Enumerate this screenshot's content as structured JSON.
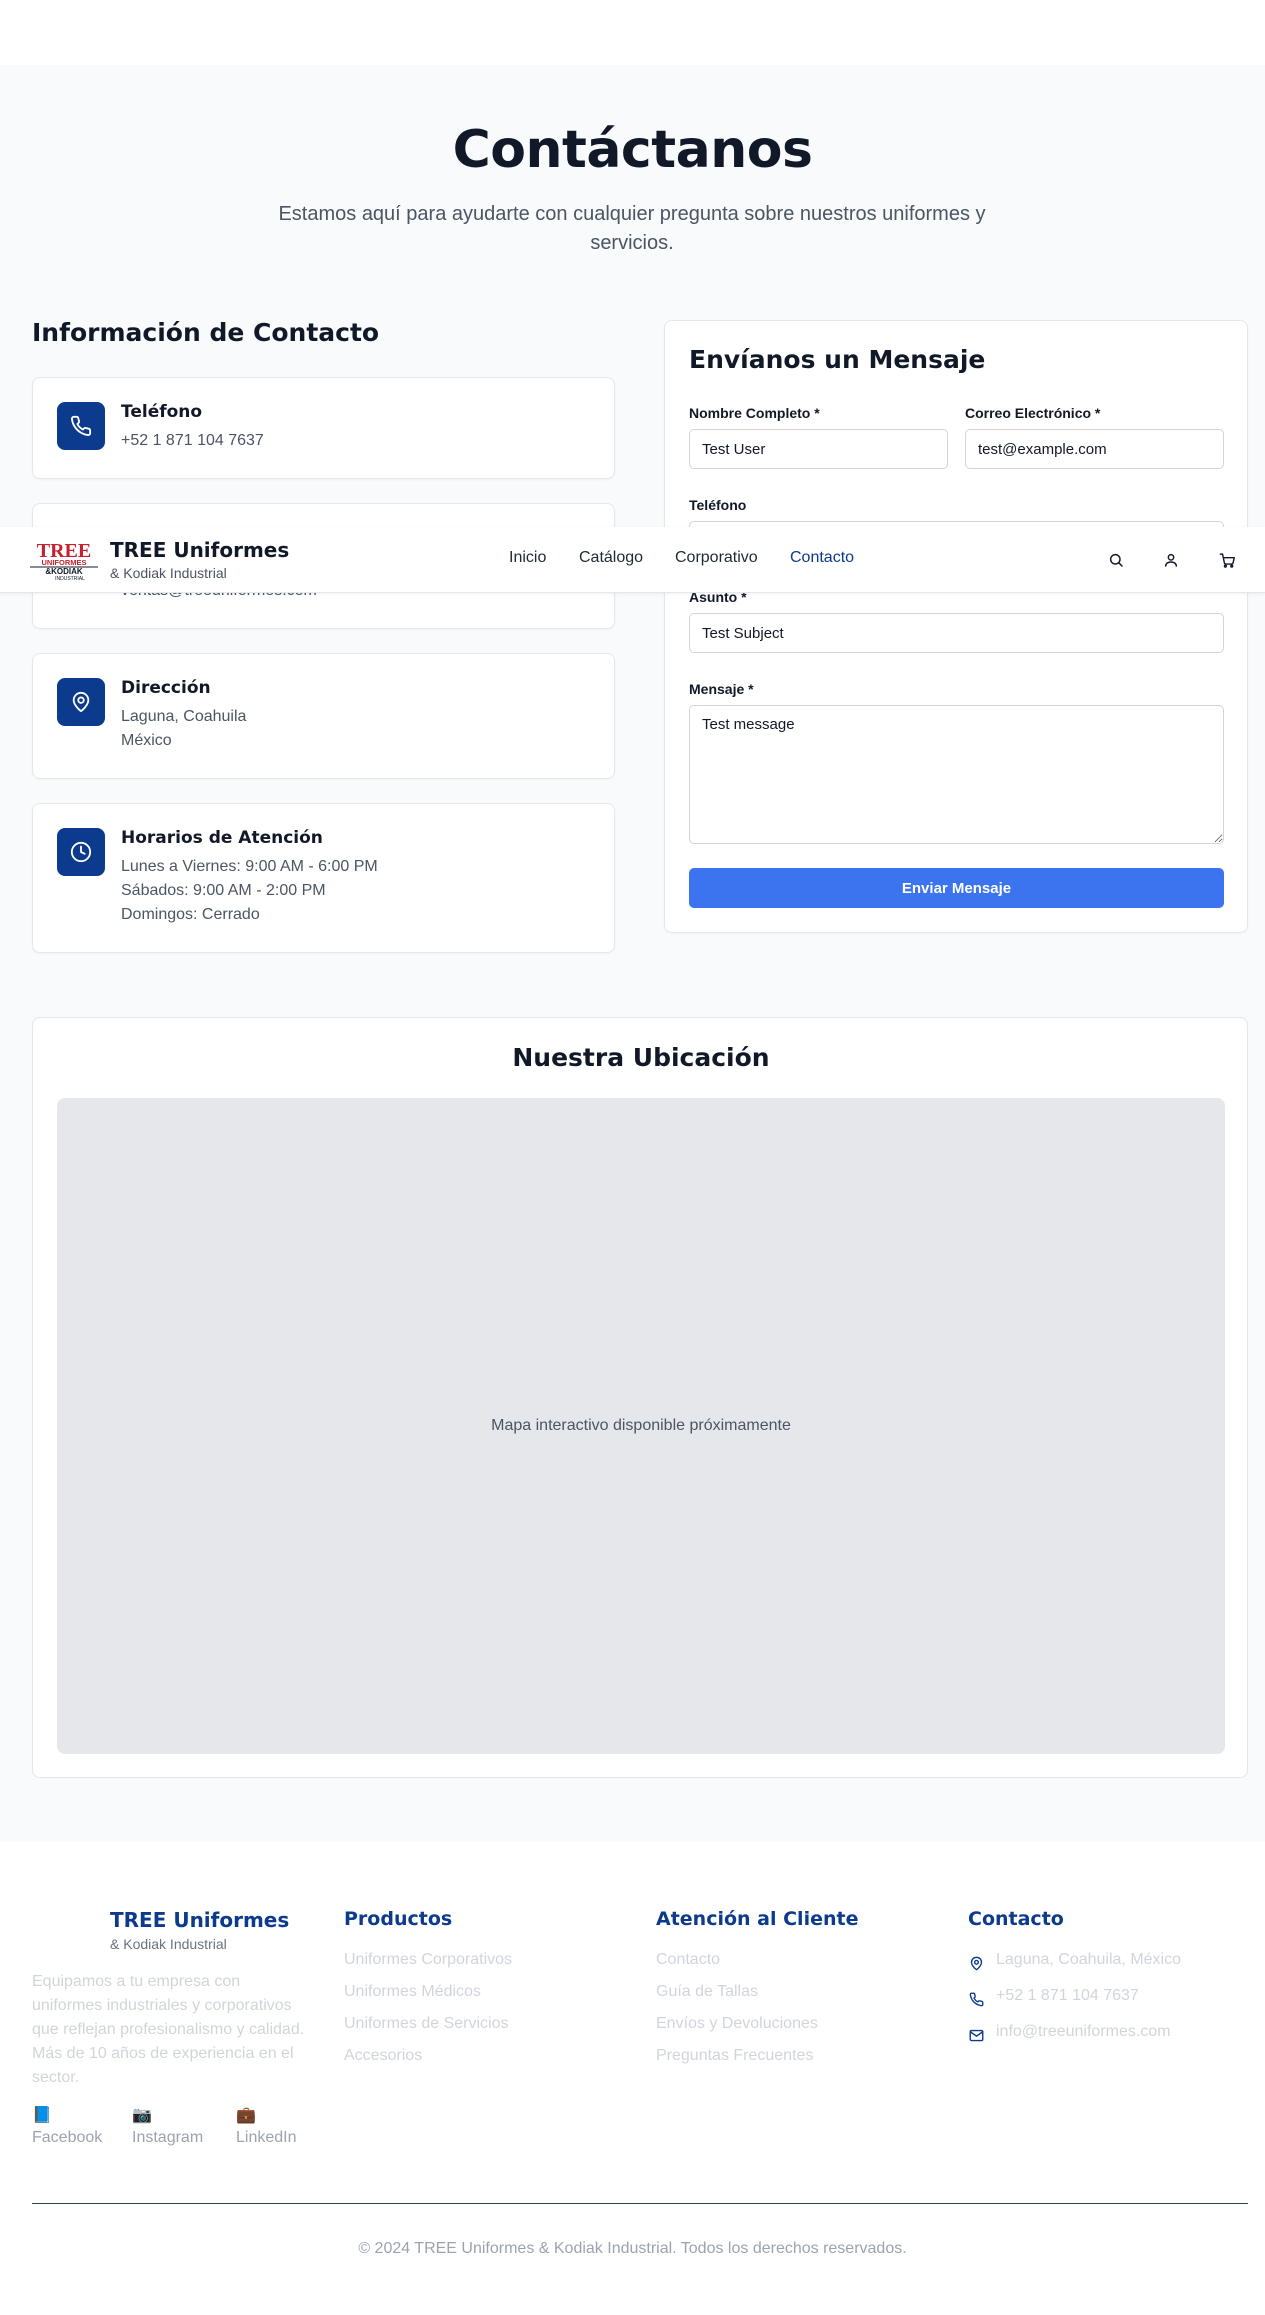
{
  "header": {
    "logo_text": "TREE UNIFORMES &KODIAK INDUSTRIAL",
    "brand": "TREE Uniformes",
    "brand_sub": "& Kodiak Industrial",
    "nav": [
      {
        "label": "Inicio"
      },
      {
        "label": "Catálogo"
      },
      {
        "label": "Corporativo"
      },
      {
        "label": "Contacto",
        "active": true
      }
    ],
    "icons": [
      "search-icon",
      "user-icon",
      "cart-icon"
    ]
  },
  "hero": {
    "title": "Contáctanos",
    "subtitle": "Estamos aquí para ayudarte con cualquier pregunta sobre nuestros uniformes y servicios."
  },
  "contact_info": {
    "title": "Información de Contacto",
    "cards": [
      {
        "icon": "phone-icon",
        "title": "Teléfono",
        "lines": [
          "+52 1 871 104 7637"
        ]
      },
      {
        "icon": "mail-icon",
        "title": "",
        "lines": [
          "ventas@treeuniformes.com"
        ]
      },
      {
        "icon": "map-pin-icon",
        "title": "Dirección",
        "lines": [
          "Laguna, Coahuila",
          "México"
        ]
      },
      {
        "icon": "clock-icon",
        "title": "Horarios de Atención",
        "lines": [
          "Lunes a Viernes: 9:00 AM - 6:00 PM",
          "Sábados: 9:00 AM - 2:00 PM",
          "Domingos: Cerrado"
        ]
      }
    ]
  },
  "form": {
    "title": "Envíanos un Mensaje",
    "name_label": "Nombre Completo *",
    "name_value": "Test User",
    "email_label": "Correo Electrónico *",
    "email_value": "test@example.com",
    "phone_label": "Teléfono",
    "phone_value": "",
    "subject_label": "Asunto *",
    "subject_value": "Test Subject",
    "message_label": "Mensaje *",
    "message_value": "Test message",
    "submit_label": "Enviar Mensaje"
  },
  "map": {
    "title": "Nuestra Ubicación",
    "placeholder": "Mapa interactivo disponible próximamente"
  },
  "footer": {
    "brand": "TREE Uniformes",
    "brand_sub": "& Kodiak Industrial",
    "description": "Equipamos a tu empresa con uniformes industriales y corporativos que reflejan profesionalismo y calidad. Más de 10 años de experiencia en el sector.",
    "social": [
      {
        "glyph": "📘",
        "label": "Facebook"
      },
      {
        "glyph": "📷",
        "label": "Instagram"
      },
      {
        "glyph": "💼",
        "label": "LinkedIn"
      }
    ],
    "products_title": "Productos",
    "products": [
      "Uniformes Corporativos",
      "Uniformes Médicos",
      "Uniformes de Servicios",
      "Accesorios"
    ],
    "service_title": "Atención al Cliente",
    "service": [
      "Contacto",
      "Guía de Tallas",
      "Envíos y Devoluciones",
      "Preguntas Frecuentes"
    ],
    "contact_title": "Contacto",
    "contact": [
      {
        "icon": "map-pin-icon",
        "text": "Laguna, Coahuila, México"
      },
      {
        "icon": "phone-icon",
        "text": "+52 1 871 104 7637"
      },
      {
        "icon": "mail-icon",
        "text": "info@treeuniformes.com"
      }
    ],
    "copyright": "© 2024 TREE Uniformes & Kodiak Industrial. Todos los derechos reservados."
  },
  "colors": {
    "brand_navy": "#0c3a8c",
    "button_blue": "#3b74ee",
    "logo_red": "#c8202f",
    "page_bg": "#f8fafc"
  }
}
